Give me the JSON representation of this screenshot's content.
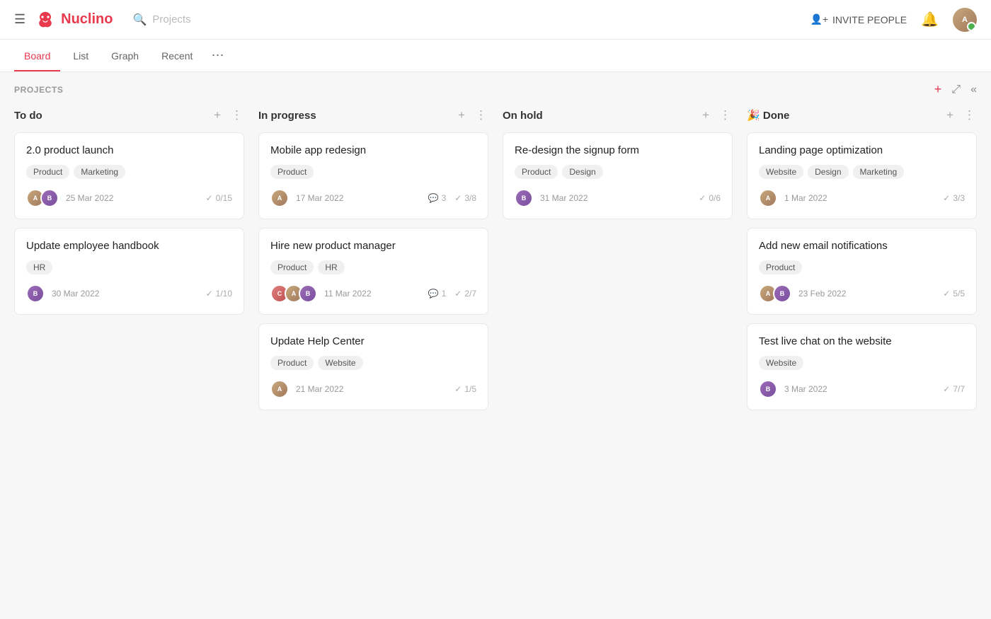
{
  "topbar": {
    "logo_text": "Nuclino",
    "search_placeholder": "Projects",
    "invite_label": "INVITE PEOPLE"
  },
  "tabs": {
    "items": [
      "Board",
      "List",
      "Graph",
      "Recent"
    ],
    "active": "Board",
    "more_icon": "⋯"
  },
  "board": {
    "section_title": "PROJECTS",
    "add_icon": "+",
    "expand_icon": "⤢",
    "collapse_icon": "«"
  },
  "columns": [
    {
      "id": "todo",
      "title": "To do",
      "emoji": "",
      "cards": [
        {
          "title": "2.0 product launch",
          "tags": [
            "Product",
            "Marketing"
          ],
          "date": "25 Mar 2022",
          "avatars": [
            "av1",
            "av2"
          ],
          "check": "0/15",
          "comments": null
        },
        {
          "title": "Update employee handbook",
          "tags": [
            "HR"
          ],
          "date": "30 Mar 2022",
          "avatars": [
            "av2"
          ],
          "check": "1/10",
          "comments": null
        }
      ]
    },
    {
      "id": "inprogress",
      "title": "In progress",
      "emoji": "",
      "cards": [
        {
          "title": "Mobile app redesign",
          "tags": [
            "Product"
          ],
          "date": "17 Mar 2022",
          "avatars": [
            "av1"
          ],
          "check": "3/8",
          "comments": "3"
        },
        {
          "title": "Hire new product manager",
          "tags": [
            "Product",
            "HR"
          ],
          "date": "11 Mar 2022",
          "avatars": [
            "av3",
            "av1",
            "av2"
          ],
          "check": "2/7",
          "comments": "1"
        },
        {
          "title": "Update Help Center",
          "tags": [
            "Product",
            "Website"
          ],
          "date": "21 Mar 2022",
          "avatars": [
            "av1"
          ],
          "check": "1/5",
          "comments": null
        }
      ]
    },
    {
      "id": "onhold",
      "title": "On hold",
      "emoji": "",
      "cards": [
        {
          "title": "Re-design the signup form",
          "tags": [
            "Product",
            "Design"
          ],
          "date": "31 Mar 2022",
          "avatars": [
            "av2"
          ],
          "check": "0/6",
          "comments": null
        }
      ]
    },
    {
      "id": "done",
      "title": "Done",
      "emoji": "🎉",
      "cards": [
        {
          "title": "Landing page optimization",
          "tags": [
            "Website",
            "Design",
            "Marketing"
          ],
          "date": "1 Mar 2022",
          "avatars": [
            "av1"
          ],
          "check": "3/3",
          "comments": null
        },
        {
          "title": "Add new email notifications",
          "tags": [
            "Product"
          ],
          "date": "23 Feb 2022",
          "avatars": [
            "av1",
            "av2"
          ],
          "check": "5/5",
          "comments": null
        },
        {
          "title": "Test live chat on the website",
          "tags": [
            "Website"
          ],
          "date": "3 Mar 2022",
          "avatars": [
            "av2"
          ],
          "check": "7/7",
          "comments": null
        }
      ]
    }
  ]
}
